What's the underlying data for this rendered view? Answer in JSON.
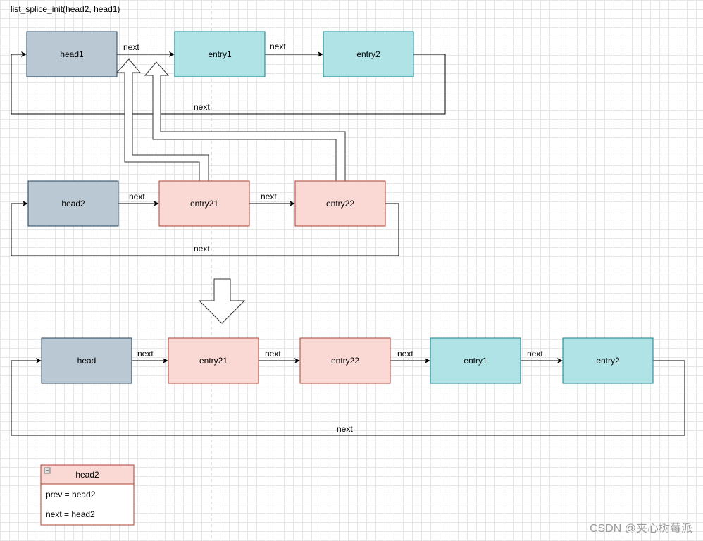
{
  "title": "list_splice_init(head2, head1)",
  "edge_label": "next",
  "colors": {
    "head_fill": "#bac8d3",
    "head_stroke": "#23445d",
    "list1_fill": "#b0e3e6",
    "list1_stroke": "#0e8088",
    "list2_fill": "#fad9d5",
    "list2_stroke": "#ae4132"
  },
  "list1": {
    "head": "head1",
    "nodes": [
      "entry1",
      "entry2"
    ]
  },
  "list2": {
    "head": "head2",
    "nodes": [
      "entry21",
      "entry22"
    ]
  },
  "result": {
    "head": "head",
    "nodes": [
      "entry21",
      "entry22",
      "entry1",
      "entry2"
    ]
  },
  "table": {
    "title": "head2",
    "rows": [
      "prev = head2",
      "next = head2"
    ],
    "collapse_icon": "minus-square-icon"
  },
  "watermark": "CSDN @夹心树莓派"
}
